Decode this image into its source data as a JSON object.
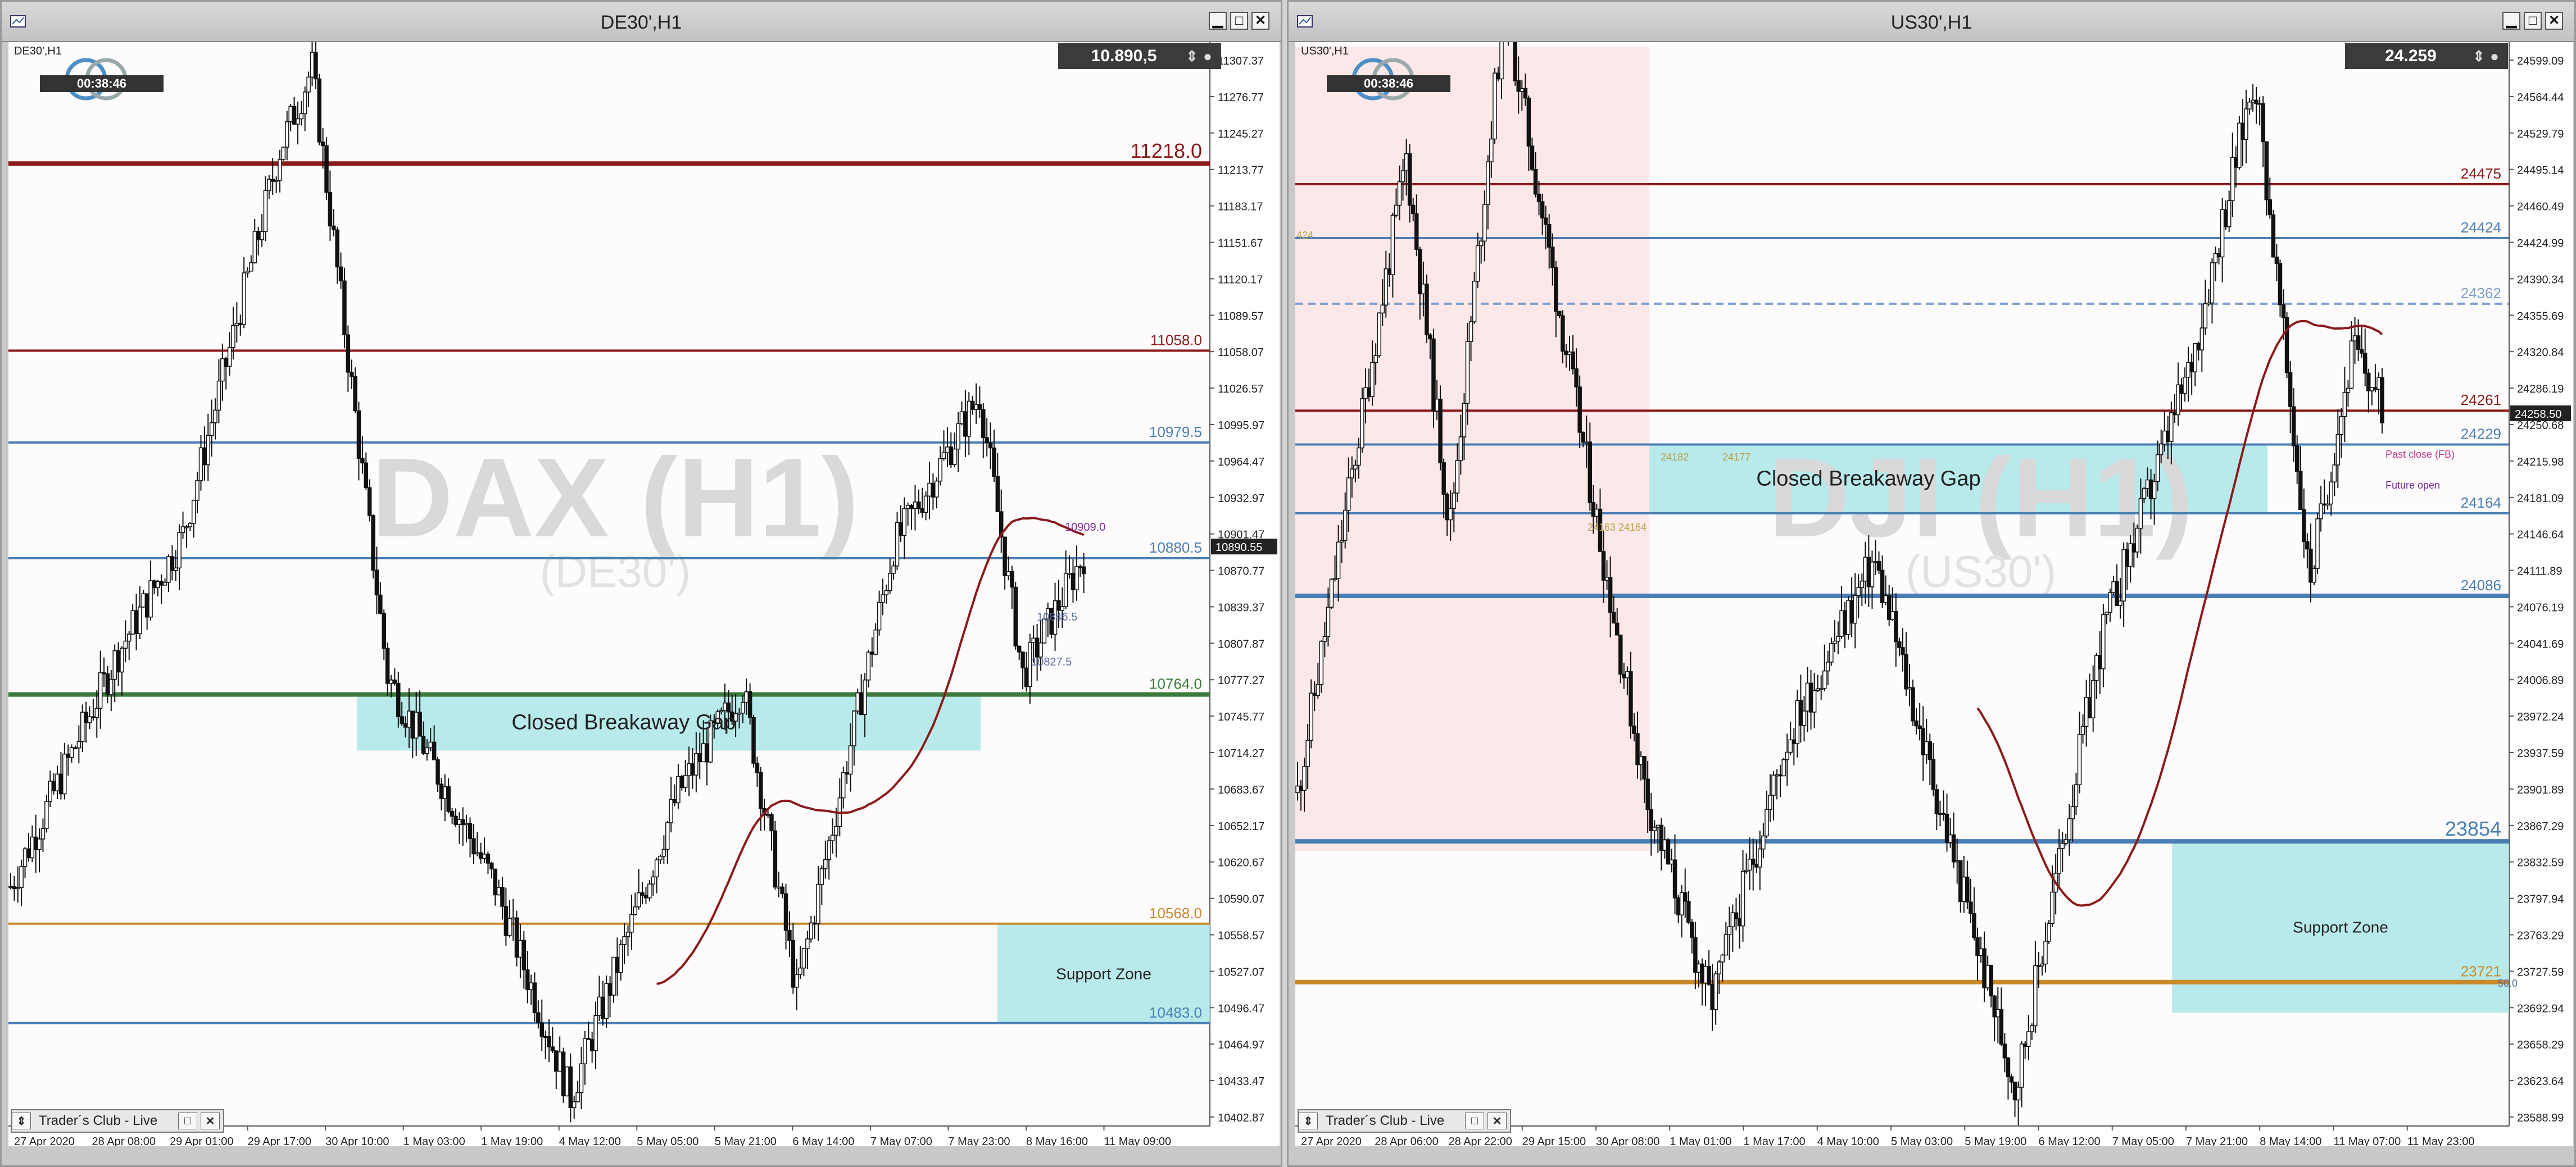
{
  "left_window": {
    "title": "DE30',H1",
    "symbol_label": "DE30',H1",
    "price_display": "10.890,5",
    "timer": "00:38:46",
    "watermark_main": "DAX (H1)",
    "watermark_sub": "(DE30')",
    "gap_label": "Closed Breakaway Gap",
    "support_label": "Support Zone",
    "bottom_panel_label": "Trader´s Club - Live",
    "axis_prices": [
      "11307.37",
      "11276.77",
      "11245.27",
      "11213.77",
      "11183.17",
      "11151.67",
      "11120.17",
      "11089.57",
      "11058.07",
      "11026.57",
      "10995.97",
      "10964.47",
      "10932.97",
      "10901.47",
      "10870.77",
      "10839.37",
      "10807.87",
      "10777.27",
      "10745.77",
      "10714.27",
      "10683.67",
      "10652.17",
      "10620.67",
      "10590.07",
      "10558.57",
      "10527.07",
      "10496.47",
      "10464.97",
      "10433.47",
      "10402.87"
    ],
    "current_price_tag": "10890.55",
    "levels": [
      {
        "label": "11218.0",
        "color": "#8b1a1a"
      },
      {
        "label": "11058.0",
        "color": "#8b1a1a"
      },
      {
        "label": "10979.5",
        "color": "#4a7fb5"
      },
      {
        "label": "10880.5",
        "color": "#4a7fb5"
      },
      {
        "label": "10764.0",
        "color": "#3a7a3a"
      },
      {
        "label": "10568.0",
        "color": "#c88a2a"
      },
      {
        "label": "10483.0",
        "color": "#4a7fb5"
      }
    ],
    "small_labels": [
      "10909.0",
      "10846.5",
      "10827.5"
    ],
    "time_labels": [
      "27 Apr 2020",
      "28 Apr 08:00",
      "29 Apr 01:00",
      "29 Apr 17:00",
      "30 Apr 10:00",
      "1 May 03:00",
      "1 May 19:00",
      "4 May 12:00",
      "5 May 05:00",
      "5 May 21:00",
      "6 May 14:00",
      "7 May 07:00",
      "7 May 23:00",
      "8 May 16:00",
      "11 May 09:00"
    ]
  },
  "right_window": {
    "title": "US30',H1",
    "symbol_label": "US30',H1",
    "price_display": "24.259",
    "timer": "00:38:46",
    "watermark_main": "DJI (H1)",
    "watermark_sub": "(US30')",
    "gap_label": "Closed Breakaway Gap",
    "support_label": "Support Zone",
    "bottom_panel_label": "Trader´s Club - Live",
    "axis_prices": [
      "24599.09",
      "24564.44",
      "24529.79",
      "24495.14",
      "24460.49",
      "24424.99",
      "24390.34",
      "24355.69",
      "24320.84",
      "24286.19",
      "24250.68",
      "24215.98",
      "24181.09",
      "24146.64",
      "24111.89",
      "24076.19",
      "24041.69",
      "24006.89",
      "23972.24",
      "23937.59",
      "23901.89",
      "23867.29",
      "23832.59",
      "23797.94",
      "23763.29",
      "23727.59",
      "23692.94",
      "23658.29",
      "23623.64",
      "23588.99"
    ],
    "current_price_tag": "24258.50",
    "levels": [
      {
        "label": "24475",
        "color": "#8b1a1a"
      },
      {
        "label": "24424",
        "color": "#4a7fb5"
      },
      {
        "label": "24362",
        "color": "#7a9fcf"
      },
      {
        "label": "24261",
        "color": "#8b1a1a"
      },
      {
        "label": "24229",
        "color": "#4a7fb5"
      },
      {
        "label": "24164",
        "color": "#4a7fb5"
      },
      {
        "label": "24086",
        "color": "#4a7fb5"
      },
      {
        "label": "23854",
        "color": "#4a7fb5"
      },
      {
        "label": "23721",
        "color": "#c88a2a"
      }
    ],
    "small_labels": [
      "424",
      "24163",
      "24164",
      "24182",
      "24177",
      "Past close (FB)",
      "Future open",
      "50.0"
    ],
    "time_labels": [
      "27 Apr 2020",
      "28 Apr 06:00",
      "28 Apr 22:00",
      "29 Apr 15:00",
      "30 Apr 08:00",
      "1 May 01:00",
      "1 May 17:00",
      "4 May 10:00",
      "5 May 03:00",
      "5 May 19:00",
      "6 May 12:00",
      "7 May 05:00",
      "7 May 21:00",
      "8 May 14:00",
      "11 May 07:00",
      "11 May 23:00"
    ]
  }
}
